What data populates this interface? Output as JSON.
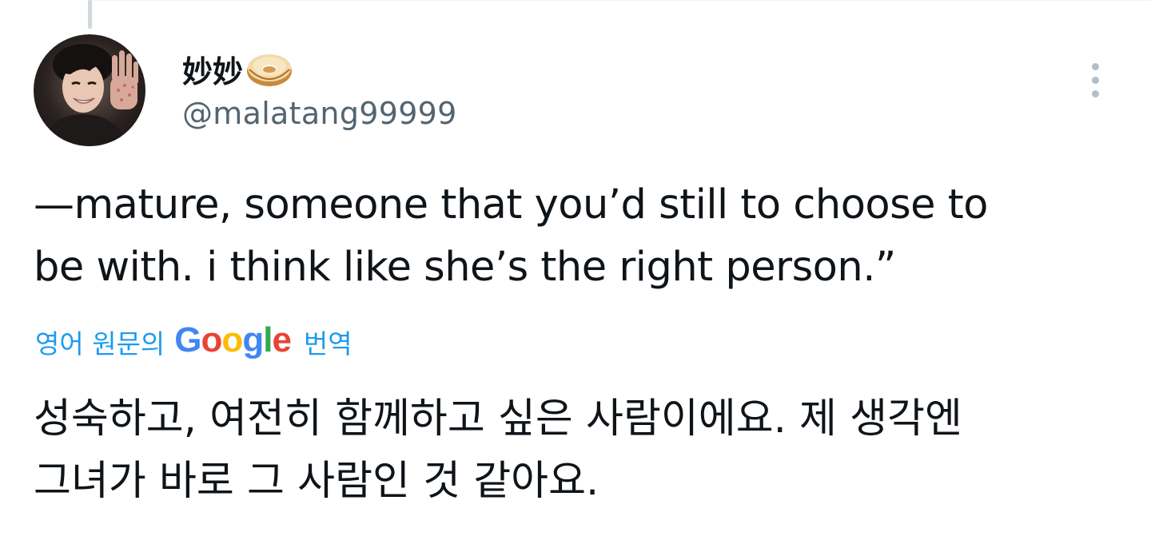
{
  "tweet": {
    "author": {
      "display_name": "妙妙",
      "name_emoji": "doughnut-icon",
      "handle": "@malatang99999",
      "avatar": "avatar"
    },
    "text_lines": [
      "—mature, someone that you’d still to choose to",
      "be with. i think like she’s the right person.”"
    ],
    "translate": {
      "prefix": "영어 원문의",
      "google_letters": [
        "G",
        "o",
        "o",
        "g",
        "l",
        "e"
      ],
      "suffix": "번역"
    },
    "translated_lines": [
      "성숙하고, 여전히 함께하고 싶은 사람이에요. 제 생각엔",
      "그녀가 바로 그 사람인 것 같아요."
    ],
    "more_icon": "more-vertical-icon"
  },
  "colors": {
    "text_primary": "#0f1419",
    "text_secondary": "#536471",
    "link_blue": "#1d9bf0",
    "google_blue": "#4285f4",
    "google_red": "#ea4335",
    "google_yellow": "#fbbc05",
    "google_green": "#34a853"
  }
}
